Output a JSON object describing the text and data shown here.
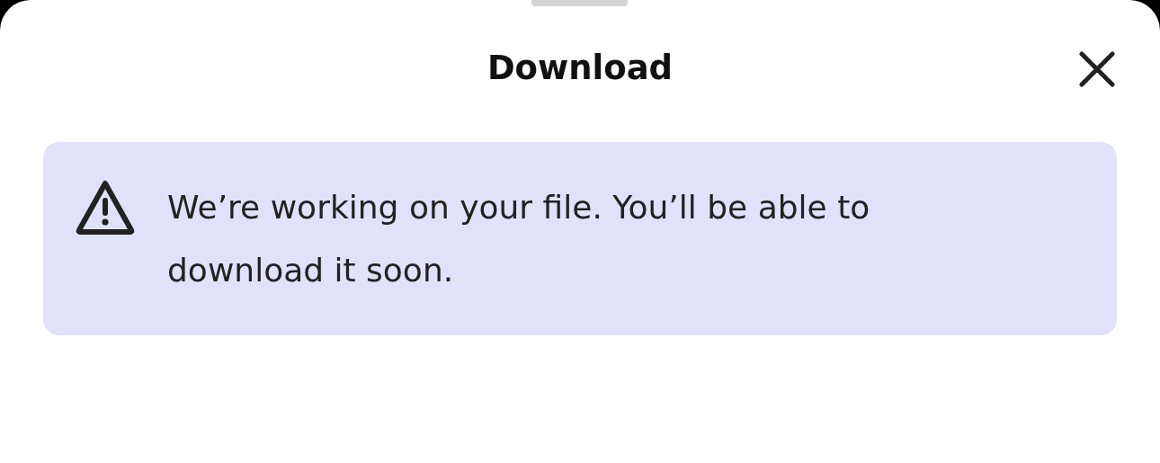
{
  "sheet": {
    "title": "Download"
  },
  "notice": {
    "kind": "warning",
    "message": "We’re working on your file. You’ll be able to download it soon."
  }
}
